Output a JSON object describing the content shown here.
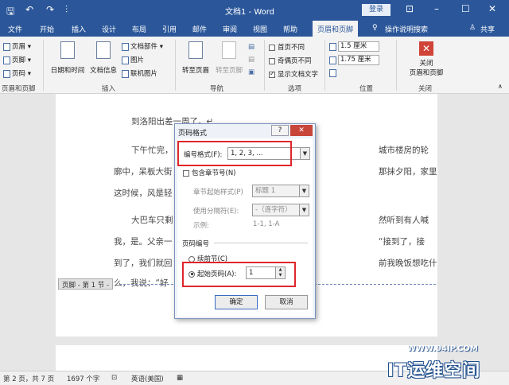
{
  "titlebar": {
    "doc_title": "文档1 - Word",
    "login": "登录",
    "qa_save": "🖫",
    "qa_undo": "↶",
    "qa_redo": "↷",
    "qa_more": "⫶"
  },
  "tabs": [
    {
      "label": "文件"
    },
    {
      "label": "开始"
    },
    {
      "label": "插入"
    },
    {
      "label": "设计"
    },
    {
      "label": "布局"
    },
    {
      "label": "引用"
    },
    {
      "label": "邮件"
    },
    {
      "label": "审阅"
    },
    {
      "label": "视图"
    },
    {
      "label": "帮助"
    },
    {
      "label": "页眉和页脚"
    },
    {
      "label": "操作说明搜索"
    },
    {
      "label": "共享"
    }
  ],
  "ribbon": {
    "header": "页眉",
    "footer": "页脚",
    "page_number": "页码",
    "group_header_footer": "页眉和页脚",
    "date_time": "日期和时间",
    "doc_info": "文档信息",
    "doc_parts": "文档部件",
    "picture": "图片",
    "online_picture": "联机图片",
    "group_insert": "插入",
    "goto_header": "转至页眉",
    "goto_footer": "转至页脚",
    "group_nav": "导航",
    "diff_first": "首页不同",
    "diff_odd_even": "奇偶页不同",
    "show_doc_text": "显示文档文字",
    "group_options": "选项",
    "header_pos": "1.5 厘米",
    "footer_pos": "1.75 厘米",
    "group_position": "位置",
    "close_label_1": "关闭",
    "close_label_2": "页眉和页脚",
    "group_close": "关闭"
  },
  "document": {
    "para1": "到洛阳出差一周了。↵",
    "para2_a": "下午忙完，",
    "para2_b": "城市楼房的轮",
    "para3_a": "廓中，呆板大街",
    "para3_b": "那抹夕阳，家里",
    "para4_a": "这时候，风是轻",
    "para5_a": "大巴车只剩",
    "para5_b": "然听到有人喊",
    "para6_a": "我，是。父亲一",
    "para6_b": "“接到了，接",
    "para7_a": "到了，我们就回",
    "para7_b": "前我晚饭想吃什",
    "para8_a": "么，我说：“好",
    "footer_tag": "页脚 - 第 1 节 -"
  },
  "dialog": {
    "title": "页码格式",
    "help": "?",
    "close": "✕",
    "number_format_label": "编号格式(F):",
    "number_format_value": "1, 2, 3, ...",
    "include_chapter": "包含章节号(N)",
    "chapter_style_label": "章节起始样式(P)",
    "chapter_style_value": "标题 1",
    "separator_label": "使用分隔符(E):",
    "separator_value": "-（连字符）",
    "example_label": "示例:",
    "example_value": "1-1, 1-A",
    "page_numbering": "页码编号",
    "continue_prev": "续前节(C)",
    "start_at": "起始页码(A):",
    "start_at_value": "1",
    "ok": "确定",
    "cancel": "取消"
  },
  "statusbar": {
    "page": "第 2 页，共 7 页",
    "words": "1697 个字",
    "language": "英语(美国)"
  },
  "watermark": {
    "url": "WWW.94IP.COM",
    "logo": "IT运维空间"
  }
}
